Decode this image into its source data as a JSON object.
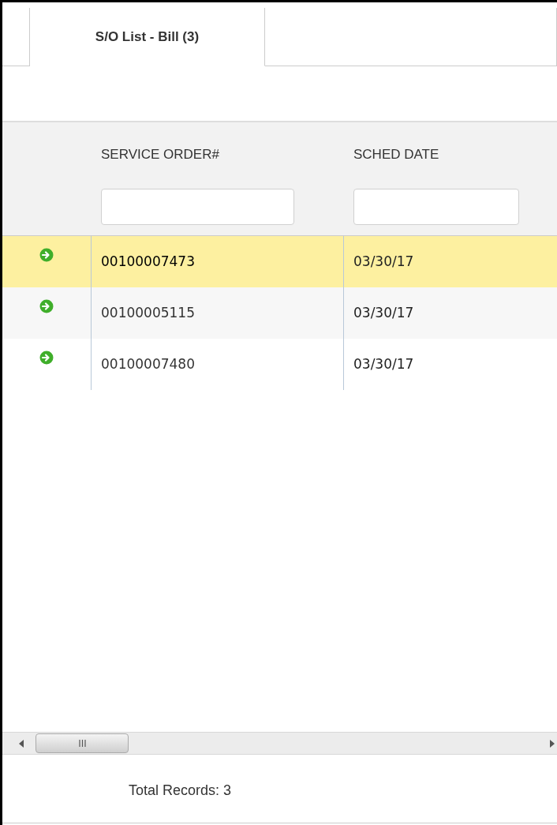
{
  "tabs": [
    {
      "label": "S/O List - Bill (3)",
      "selected": true
    }
  ],
  "table": {
    "columns": [
      {
        "label": "SERVICE ORDER#"
      },
      {
        "label": "SCHED DATE"
      }
    ],
    "rows": [
      {
        "service_order": "00100007473",
        "sched_date": "03/30/17",
        "selected": true
      },
      {
        "service_order": "00100005115",
        "sched_date": "03/30/17",
        "selected": false
      },
      {
        "service_order": "00100007480",
        "sched_date": "03/30/17",
        "selected": false
      }
    ]
  },
  "status_bar": {
    "total": "Total Records: 3"
  }
}
